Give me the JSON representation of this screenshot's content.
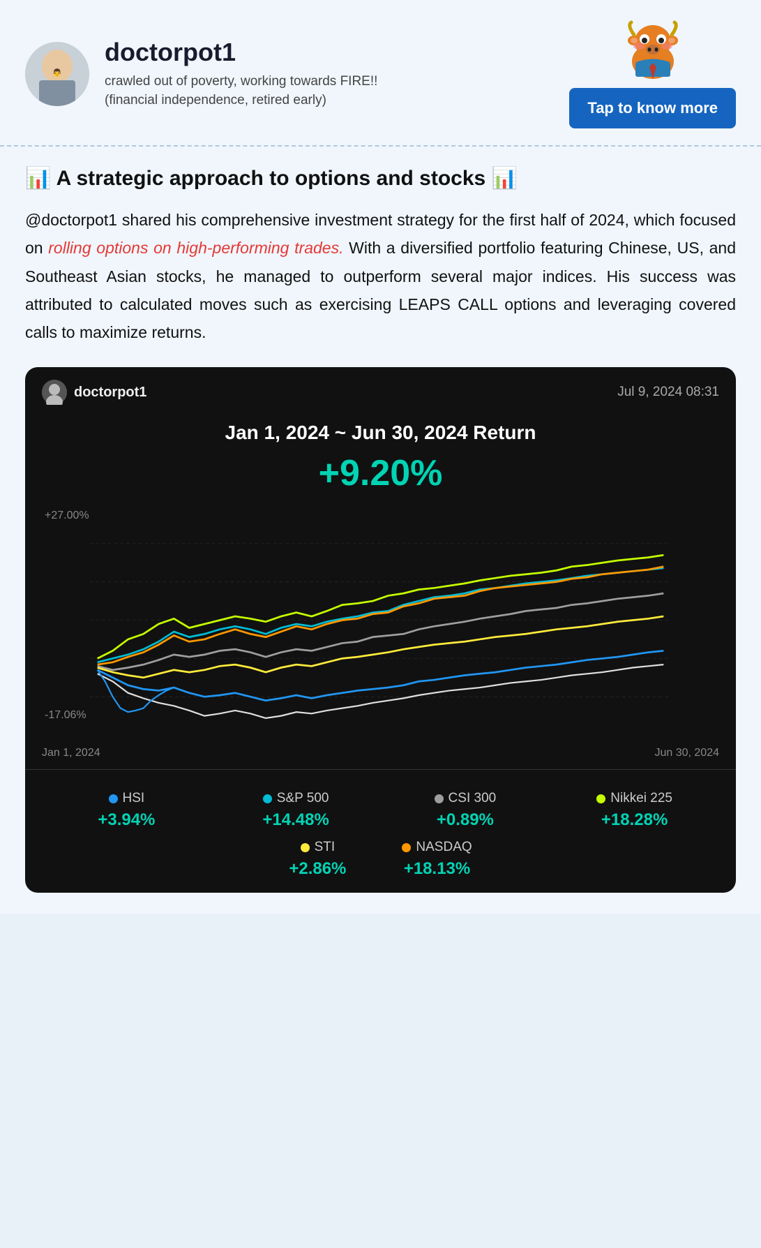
{
  "header": {
    "username": "doctorpot1",
    "bio_line1": "crawled out of poverty, working towards FIRE!!",
    "bio_line2": "(financial independence, retired early)",
    "tap_button": "Tap to know more"
  },
  "article": {
    "title": "📊 A strategic approach to options and stocks 📊",
    "body_part1": "@doctorpot1 shared his comprehensive investment strategy for the first half of 2024, which focused on ",
    "highlight": "rolling options on high-performing trades.",
    "body_part2": " With a diversified portfolio featuring Chinese, US, and Southeast Asian stocks, he managed to outperform several major indices. His success was attributed to calculated moves such as exercising LEAPS CALL options and leveraging covered calls to maximize returns."
  },
  "chart": {
    "user": "doctorpot1",
    "date": "Jul 9, 2024 08:31",
    "title": "Jan 1, 2024 ~ Jun 30, 2024 Return",
    "return_value": "+9.20%",
    "y_top": "+27.00%",
    "y_bottom": "-17.06%",
    "x_left": "Jan 1, 2024",
    "x_right": "Jun 30, 2024",
    "legend": [
      {
        "name": "HSI",
        "color": "#4fc3f7",
        "value": "+3.94%",
        "dot_color": "#2196f3"
      },
      {
        "name": "S&P 500",
        "color": "#00bcd4",
        "value": "+14.48%",
        "dot_color": "#00bcd4"
      },
      {
        "name": "CSI 300",
        "color": "#9e9e9e",
        "value": "+0.89%",
        "dot_color": "#9e9e9e"
      },
      {
        "name": "Nikkei 225",
        "color": "#c6ff00",
        "value": "+18.28%",
        "dot_color": "#c6ff00"
      }
    ],
    "legend2": [
      {
        "name": "STI",
        "color": "#ffeb3b",
        "value": "+2.86%",
        "dot_color": "#ffeb3b"
      },
      {
        "name": "NASDAQ",
        "color": "#ff9800",
        "value": "+18.13%",
        "dot_color": "#ff9800"
      }
    ]
  }
}
